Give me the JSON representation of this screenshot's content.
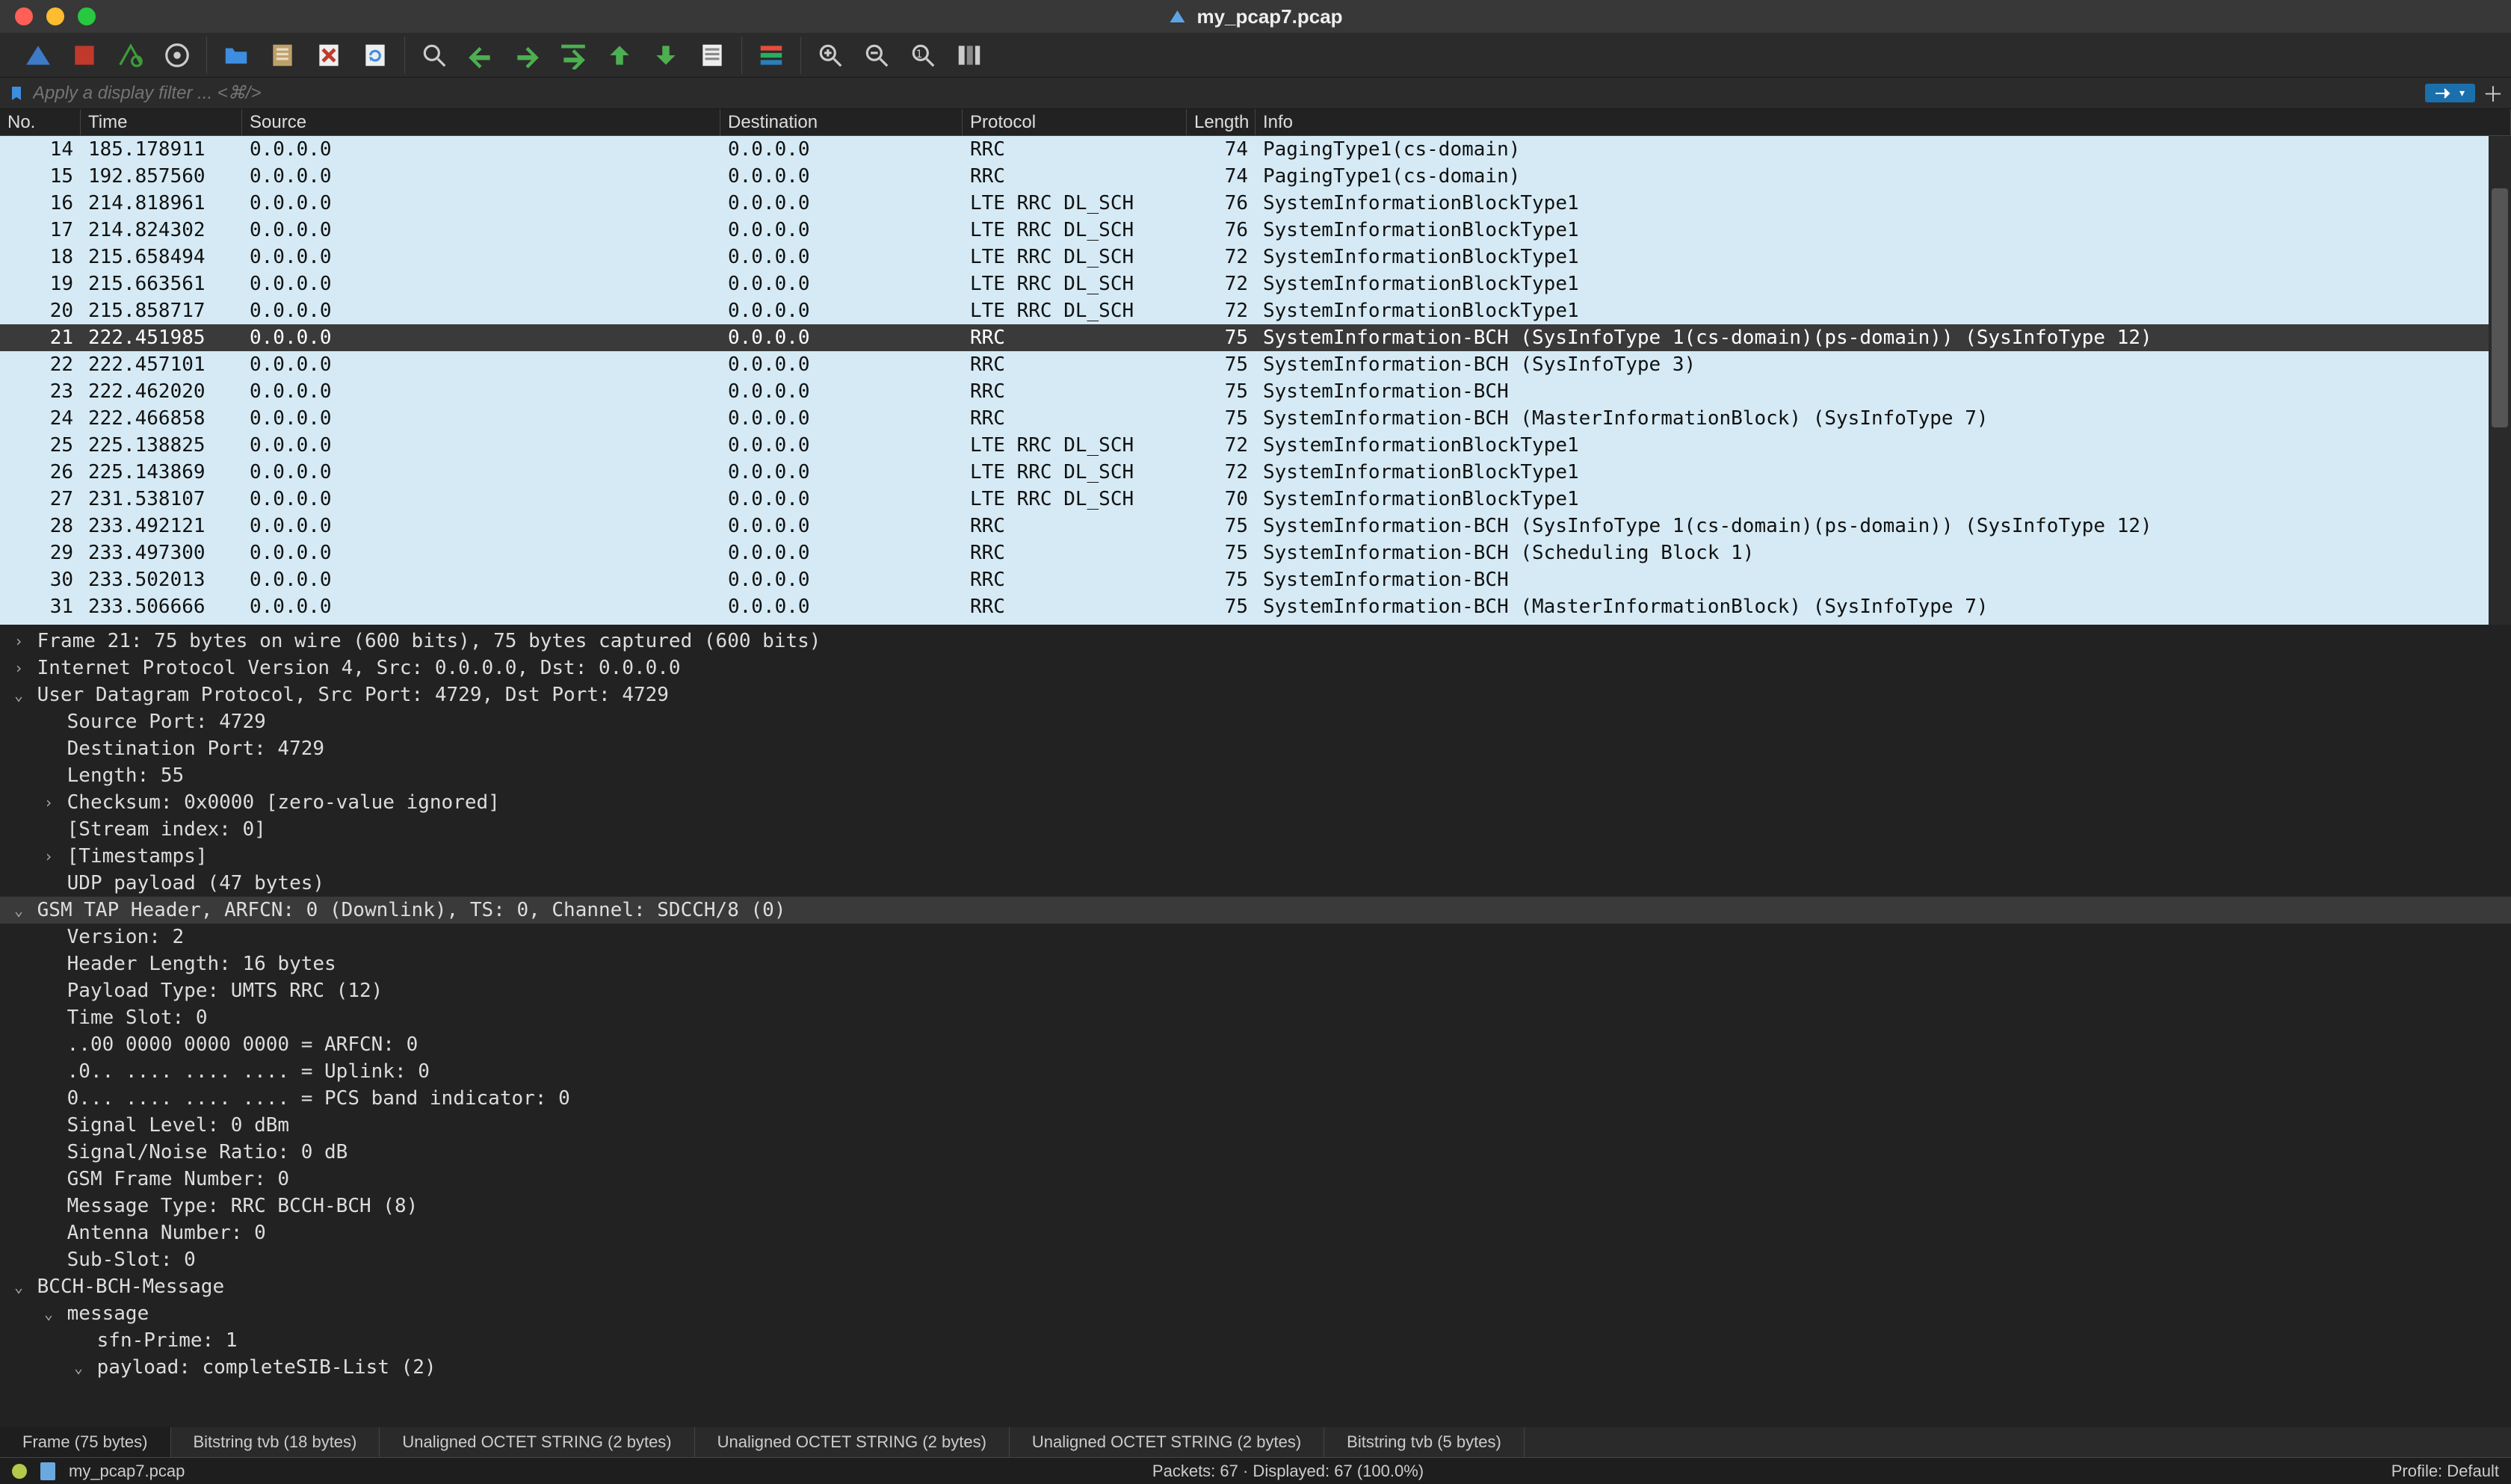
{
  "window_title": "my_pcap7.pcap",
  "filter_placeholder": "Apply a display filter ... <⌘/>",
  "columns": [
    "No.",
    "Time",
    "Source",
    "Destination",
    "Protocol",
    "Length",
    "Info"
  ],
  "selected_no": 21,
  "packets": [
    {
      "no": 14,
      "time": "185.178911",
      "src": "0.0.0.0",
      "dst": "0.0.0.0",
      "proto": "RRC",
      "len": 74,
      "info": "PagingType1(cs-domain)"
    },
    {
      "no": 15,
      "time": "192.857560",
      "src": "0.0.0.0",
      "dst": "0.0.0.0",
      "proto": "RRC",
      "len": 74,
      "info": "PagingType1(cs-domain)"
    },
    {
      "no": 16,
      "time": "214.818961",
      "src": "0.0.0.0",
      "dst": "0.0.0.0",
      "proto": "LTE RRC DL_SCH",
      "len": 76,
      "info": "SystemInformationBlockType1"
    },
    {
      "no": 17,
      "time": "214.824302",
      "src": "0.0.0.0",
      "dst": "0.0.0.0",
      "proto": "LTE RRC DL_SCH",
      "len": 76,
      "info": "SystemInformationBlockType1"
    },
    {
      "no": 18,
      "time": "215.658494",
      "src": "0.0.0.0",
      "dst": "0.0.0.0",
      "proto": "LTE RRC DL_SCH",
      "len": 72,
      "info": "SystemInformationBlockType1"
    },
    {
      "no": 19,
      "time": "215.663561",
      "src": "0.0.0.0",
      "dst": "0.0.0.0",
      "proto": "LTE RRC DL_SCH",
      "len": 72,
      "info": "SystemInformationBlockType1"
    },
    {
      "no": 20,
      "time": "215.858717",
      "src": "0.0.0.0",
      "dst": "0.0.0.0",
      "proto": "LTE RRC DL_SCH",
      "len": 72,
      "info": "SystemInformationBlockType1"
    },
    {
      "no": 21,
      "time": "222.451985",
      "src": "0.0.0.0",
      "dst": "0.0.0.0",
      "proto": "RRC",
      "len": 75,
      "info": "SystemInformation-BCH (SysInfoType 1(cs-domain)(ps-domain)) (SysInfoType 12)"
    },
    {
      "no": 22,
      "time": "222.457101",
      "src": "0.0.0.0",
      "dst": "0.0.0.0",
      "proto": "RRC",
      "len": 75,
      "info": "SystemInformation-BCH (SysInfoType 3)"
    },
    {
      "no": 23,
      "time": "222.462020",
      "src": "0.0.0.0",
      "dst": "0.0.0.0",
      "proto": "RRC",
      "len": 75,
      "info": "SystemInformation-BCH"
    },
    {
      "no": 24,
      "time": "222.466858",
      "src": "0.0.0.0",
      "dst": "0.0.0.0",
      "proto": "RRC",
      "len": 75,
      "info": "SystemInformation-BCH (MasterInformationBlock) (SysInfoType 7)"
    },
    {
      "no": 25,
      "time": "225.138825",
      "src": "0.0.0.0",
      "dst": "0.0.0.0",
      "proto": "LTE RRC DL_SCH",
      "len": 72,
      "info": "SystemInformationBlockType1"
    },
    {
      "no": 26,
      "time": "225.143869",
      "src": "0.0.0.0",
      "dst": "0.0.0.0",
      "proto": "LTE RRC DL_SCH",
      "len": 72,
      "info": "SystemInformationBlockType1"
    },
    {
      "no": 27,
      "time": "231.538107",
      "src": "0.0.0.0",
      "dst": "0.0.0.0",
      "proto": "LTE RRC DL_SCH",
      "len": 70,
      "info": "SystemInformationBlockType1"
    },
    {
      "no": 28,
      "time": "233.492121",
      "src": "0.0.0.0",
      "dst": "0.0.0.0",
      "proto": "RRC",
      "len": 75,
      "info": "SystemInformation-BCH (SysInfoType 1(cs-domain)(ps-domain)) (SysInfoType 12)"
    },
    {
      "no": 29,
      "time": "233.497300",
      "src": "0.0.0.0",
      "dst": "0.0.0.0",
      "proto": "RRC",
      "len": 75,
      "info": "SystemInformation-BCH (Scheduling Block 1)"
    },
    {
      "no": 30,
      "time": "233.502013",
      "src": "0.0.0.0",
      "dst": "0.0.0.0",
      "proto": "RRC",
      "len": 75,
      "info": "SystemInformation-BCH"
    },
    {
      "no": 31,
      "time": "233.506666",
      "src": "0.0.0.0",
      "dst": "0.0.0.0",
      "proto": "RRC",
      "len": 75,
      "info": "SystemInformation-BCH (MasterInformationBlock) (SysInfoType 7)"
    }
  ],
  "details": [
    {
      "indent": 0,
      "caret": ">",
      "text": "Frame 21: 75 bytes on wire (600 bits), 75 bytes captured (600 bits)"
    },
    {
      "indent": 0,
      "caret": ">",
      "text": "Internet Protocol Version 4, Src: 0.0.0.0, Dst: 0.0.0.0"
    },
    {
      "indent": 0,
      "caret": "v",
      "text": "User Datagram Protocol, Src Port: 4729, Dst Port: 4729"
    },
    {
      "indent": 1,
      "caret": "",
      "text": "Source Port: 4729"
    },
    {
      "indent": 1,
      "caret": "",
      "text": "Destination Port: 4729"
    },
    {
      "indent": 1,
      "caret": "",
      "text": "Length: 55"
    },
    {
      "indent": 1,
      "caret": ">",
      "text": "Checksum: 0x0000 [zero-value ignored]"
    },
    {
      "indent": 1,
      "caret": "",
      "text": "[Stream index: 0]"
    },
    {
      "indent": 1,
      "caret": ">",
      "text": "[Timestamps]"
    },
    {
      "indent": 1,
      "caret": "",
      "text": "UDP payload (47 bytes)"
    },
    {
      "indent": 0,
      "caret": "v",
      "text": "GSM TAP Header, ARFCN: 0 (Downlink), TS: 0, Channel: SDCCH/8 (0)",
      "hl": true
    },
    {
      "indent": 1,
      "caret": "",
      "text": "Version: 2"
    },
    {
      "indent": 1,
      "caret": "",
      "text": "Header Length: 16 bytes"
    },
    {
      "indent": 1,
      "caret": "",
      "text": "Payload Type: UMTS RRC (12)"
    },
    {
      "indent": 1,
      "caret": "",
      "text": "Time Slot: 0"
    },
    {
      "indent": 1,
      "caret": "",
      "text": "..00 0000 0000 0000 = ARFCN: 0"
    },
    {
      "indent": 1,
      "caret": "",
      "text": ".0.. .... .... .... = Uplink: 0"
    },
    {
      "indent": 1,
      "caret": "",
      "text": "0... .... .... .... = PCS band indicator: 0"
    },
    {
      "indent": 1,
      "caret": "",
      "text": "Signal Level: 0 dBm"
    },
    {
      "indent": 1,
      "caret": "",
      "text": "Signal/Noise Ratio: 0 dB"
    },
    {
      "indent": 1,
      "caret": "",
      "text": "GSM Frame Number: 0"
    },
    {
      "indent": 1,
      "caret": "",
      "text": "Message Type: RRC BCCH-BCH (8)"
    },
    {
      "indent": 1,
      "caret": "",
      "text": "Antenna Number: 0"
    },
    {
      "indent": 1,
      "caret": "",
      "text": "Sub-Slot: 0"
    },
    {
      "indent": 0,
      "caret": "v",
      "text": "BCCH-BCH-Message"
    },
    {
      "indent": 1,
      "caret": "v",
      "text": "message"
    },
    {
      "indent": 2,
      "caret": "",
      "text": "sfn-Prime: 1"
    },
    {
      "indent": 2,
      "caret": "v",
      "text": "payload: completeSIB-List (2)"
    }
  ],
  "tabs": [
    "Frame (75 bytes)",
    "Bitstring tvb (18 bytes)",
    "Unaligned OCTET STRING (2 bytes)",
    "Unaligned OCTET STRING (2 bytes)",
    "Unaligned OCTET STRING (2 bytes)",
    "Bitstring tvb (5 bytes)"
  ],
  "status": {
    "file": "my_pcap7.pcap",
    "packets": "Packets: 67 · Displayed: 67 (100.0%)",
    "profile": "Profile: Default"
  }
}
